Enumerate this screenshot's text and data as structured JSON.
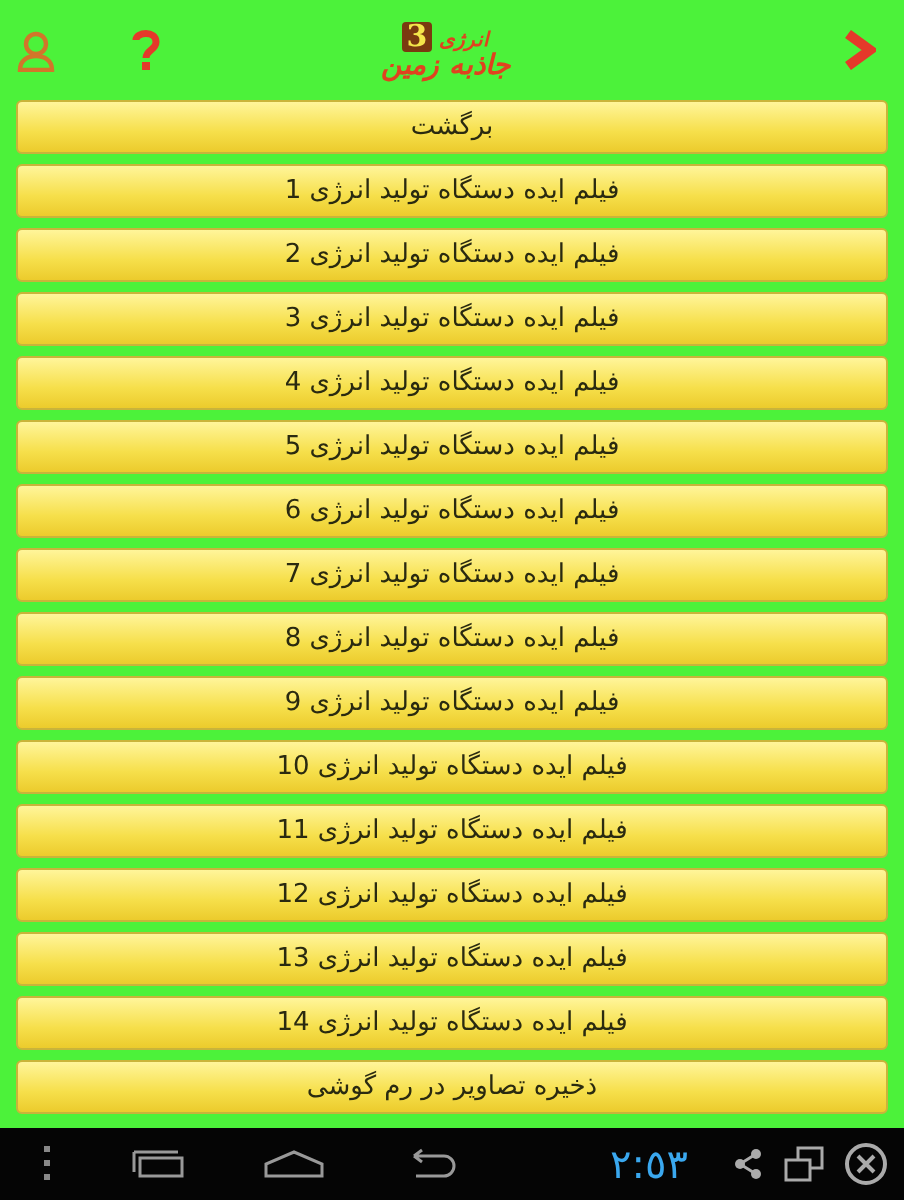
{
  "header": {
    "logo": {
      "top": "انرژی",
      "main": "جاذبه زمین",
      "number": "3"
    }
  },
  "buttons": [
    {
      "label": "برگشت"
    },
    {
      "label": "فیلم ایده دستگاه تولید انرژی 1"
    },
    {
      "label": "فیلم ایده دستگاه تولید انرژی 2"
    },
    {
      "label": "فیلم ایده دستگاه تولید انرژی 3"
    },
    {
      "label": "فیلم ایده دستگاه تولید انرژی 4"
    },
    {
      "label": "فیلم ایده دستگاه تولید انرژی 5"
    },
    {
      "label": "فیلم ایده دستگاه تولید انرژی 6"
    },
    {
      "label": "فیلم ایده دستگاه تولید انرژی 7"
    },
    {
      "label": "فیلم ایده دستگاه تولید انرژی 8"
    },
    {
      "label": "فیلم ایده دستگاه تولید انرژی 9"
    },
    {
      "label": "فیلم ایده دستگاه تولید انرژی 10"
    },
    {
      "label": "فیلم ایده دستگاه تولید انرژی 11"
    },
    {
      "label": "فیلم ایده دستگاه تولید انرژی 12"
    },
    {
      "label": "فیلم ایده دستگاه تولید انرژی 13"
    },
    {
      "label": "فیلم ایده دستگاه تولید انرژی 14"
    },
    {
      "label": "ذخیره تصاویر در رم گوشی"
    }
  ],
  "status_bar": {
    "time": "٢:٥٣"
  }
}
